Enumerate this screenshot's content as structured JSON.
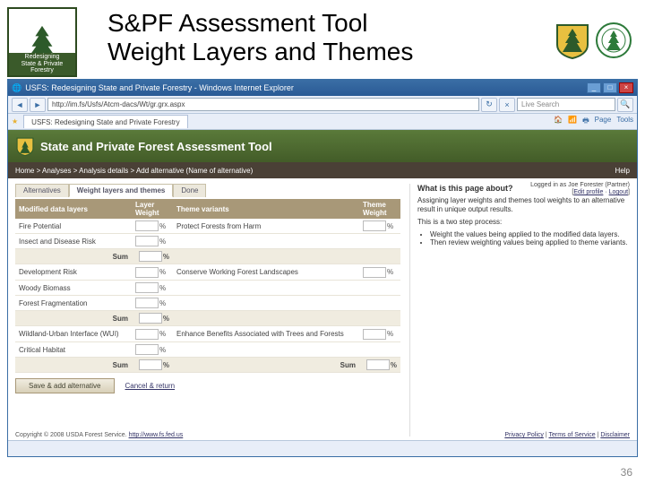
{
  "slide": {
    "title_line1": "S&PF Assessment Tool",
    "title_line2": "Weight Layers and Themes",
    "left_logo_label": "Redesigning",
    "left_logo_sub": "State & Private Forestry",
    "number": "36"
  },
  "browser": {
    "window_title": "USFS: Redesigning State and Private Forestry - Windows Internet Explorer",
    "address": "http://im.fs/Usfs/Atcm-dacs/Wt/gr.grx.aspx",
    "search_placeholder": "Live Search",
    "tab_title": "USFS: Redesigning State and Private Forestry",
    "tools": {
      "home": "Home",
      "feeds": "Feeds",
      "print": "Print",
      "page": "Page",
      "tools": "Tools"
    }
  },
  "app": {
    "banner_title": "State and Private Forest Assessment Tool",
    "login_as": "Logged in as Joe Forester (Partner)",
    "login_links": {
      "edit": "Edit profile",
      "logout": "Logout"
    },
    "breadcrumb": "Home > Analyses > Analysis details > Add alternative (Name of alternative)",
    "help": "Help",
    "tabs": {
      "alt": "Alternatives",
      "wlt": "Weight layers and themes",
      "done": "Done"
    },
    "table": {
      "hdr_layers": "Modified data layers",
      "hdr_layer_wt": "Layer Weight",
      "hdr_themes": "Theme variants",
      "hdr_theme_wt": "Theme Weight",
      "layers": [
        "Fire Potential",
        "Insect and Disease Risk",
        "Development Risk",
        "Woody Biomass",
        "Forest Fragmentation",
        "Wildland-Urban Interface (WUI)",
        "Critical Habitat"
      ],
      "themes": [
        "Protect Forests from Harm",
        "Conserve Working Forest Landscapes",
        "Enhance Benefits Associated with Trees and Forests"
      ],
      "sum_label": "Sum",
      "pct": "%"
    },
    "buttons": {
      "save": "Save & add alternative",
      "cancel": "Cancel & return"
    },
    "sidebar": {
      "heading": "What is this page about?",
      "p1": "Assigning layer weights and themes tool weights to an alternative result in unique output results.",
      "p2": "This is a two step process:",
      "b1": "Weight the values being applied to the modified data layers.",
      "b2": "Then review weighting values being applied to theme variants."
    },
    "footer": {
      "copyright": "Copyright © 2008 USDA Forest Service.",
      "url": "http://www.fs.fed.us",
      "privacy": "Privacy Policy",
      "terms": "Terms of Service",
      "disclaimer": "Disclaimer"
    }
  }
}
